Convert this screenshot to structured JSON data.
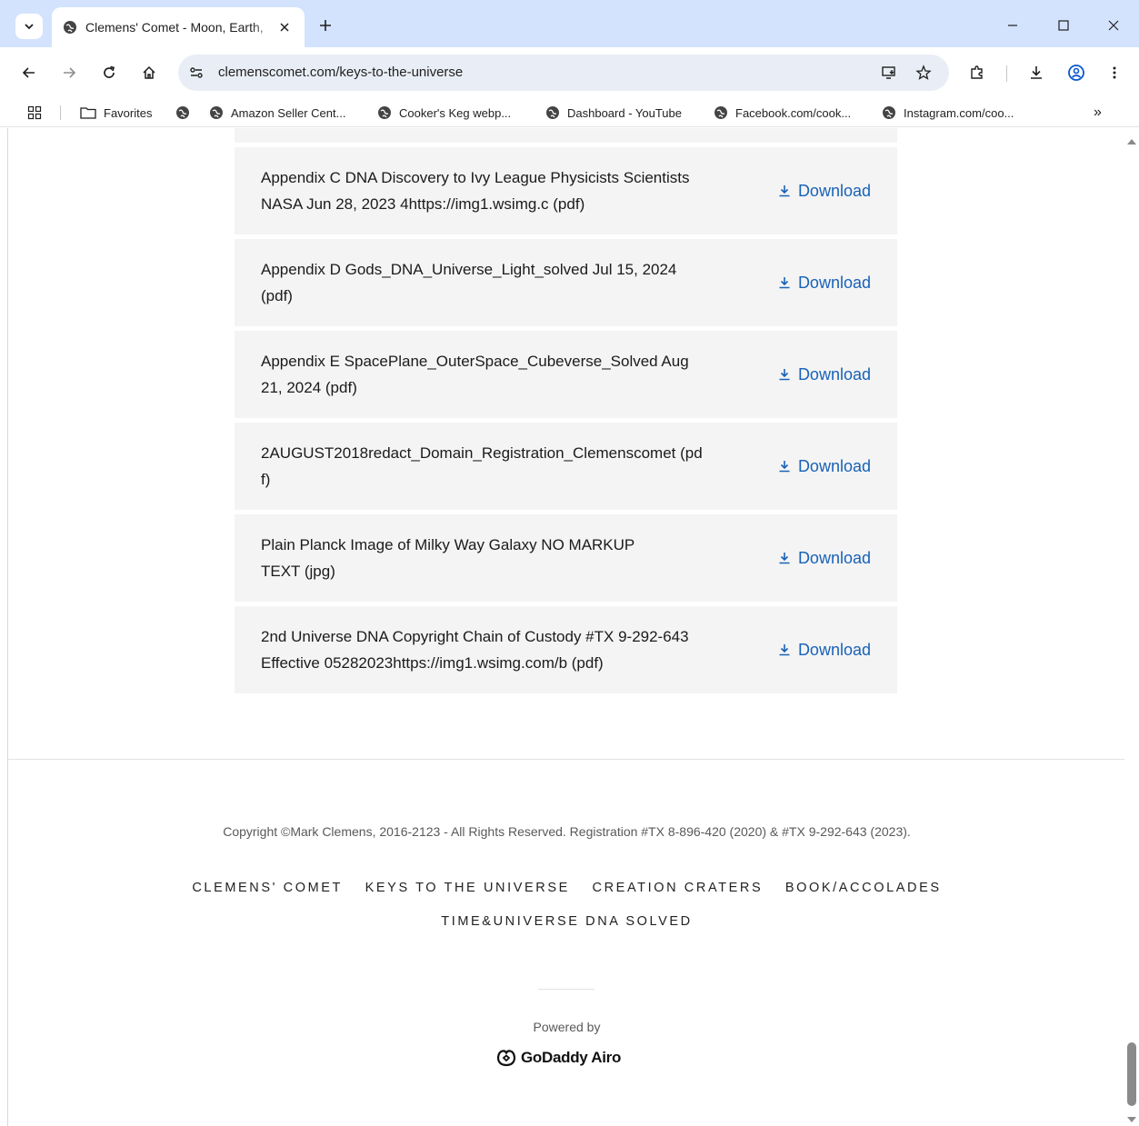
{
  "browser": {
    "tab_title": "Clemens' Comet - Moon, Earth, ",
    "url": "clemenscomet.com/keys-to-the-universe",
    "bookmarks": [
      {
        "label": "Favorites",
        "icon": "folder-icon"
      },
      {
        "label": "",
        "icon": "globe-icon"
      },
      {
        "label": "Amazon Seller Cent...",
        "icon": "globe-icon"
      },
      {
        "label": "Cooker's Keg webp...",
        "icon": "globe-icon"
      },
      {
        "label": "Dashboard - YouTube",
        "icon": "globe-icon"
      },
      {
        "label": "Facebook.com/cook...",
        "icon": "globe-icon"
      },
      {
        "label": "Instagram.com/coo...",
        "icon": "globe-icon"
      }
    ],
    "overflow_label": "»"
  },
  "files": [
    {
      "name": "Appendix C DNA Discovery to Ivy League Physicists Scientists NASA Jun 28, 2023 4https://img1.wsimg.c (pdf)",
      "action": "Download"
    },
    {
      "name": "Appendix D Gods_DNA_Universe_Light_solved Jul 15, 2024 (pdf)",
      "action": "Download"
    },
    {
      "name": "Appendix E SpacePlane_OuterSpace_Cubeverse_Solved Aug 21, 2024 (pdf)",
      "action": "Download"
    },
    {
      "name": "2AUGUST2018redact_Domain_Registration_Clemenscomet (pdf)",
      "action": "Download"
    },
    {
      "name": "Plain Planck Image of Milky Way Galaxy NO MARKUP TEXT (jpg)",
      "action": "Download"
    },
    {
      "name": "2nd Universe DNA Copyright Chain of Custody #TX 9-292-643 Effective 05282023https://img1.wsimg.com/b (pdf)",
      "action": "Download"
    }
  ],
  "footer": {
    "copyright": "Copyright ©Mark Clemens, 2016-2123 - All Rights Reserved. Registration #TX 8-896-420 (2020) & #TX 9-292-643 (2023).",
    "nav": [
      "CLEMENS' COMET",
      "KEYS TO THE UNIVERSE",
      "CREATION CRATERS",
      "BOOK/ACCOLADES",
      "TIME&UNIVERSE DNA SOLVED"
    ],
    "powered_by": "Powered by",
    "brand": "GoDaddy Airo"
  },
  "colors": {
    "accent_link": "#1862b8",
    "tabstrip": "#d3e3fd",
    "row_bg": "#f4f4f4"
  }
}
